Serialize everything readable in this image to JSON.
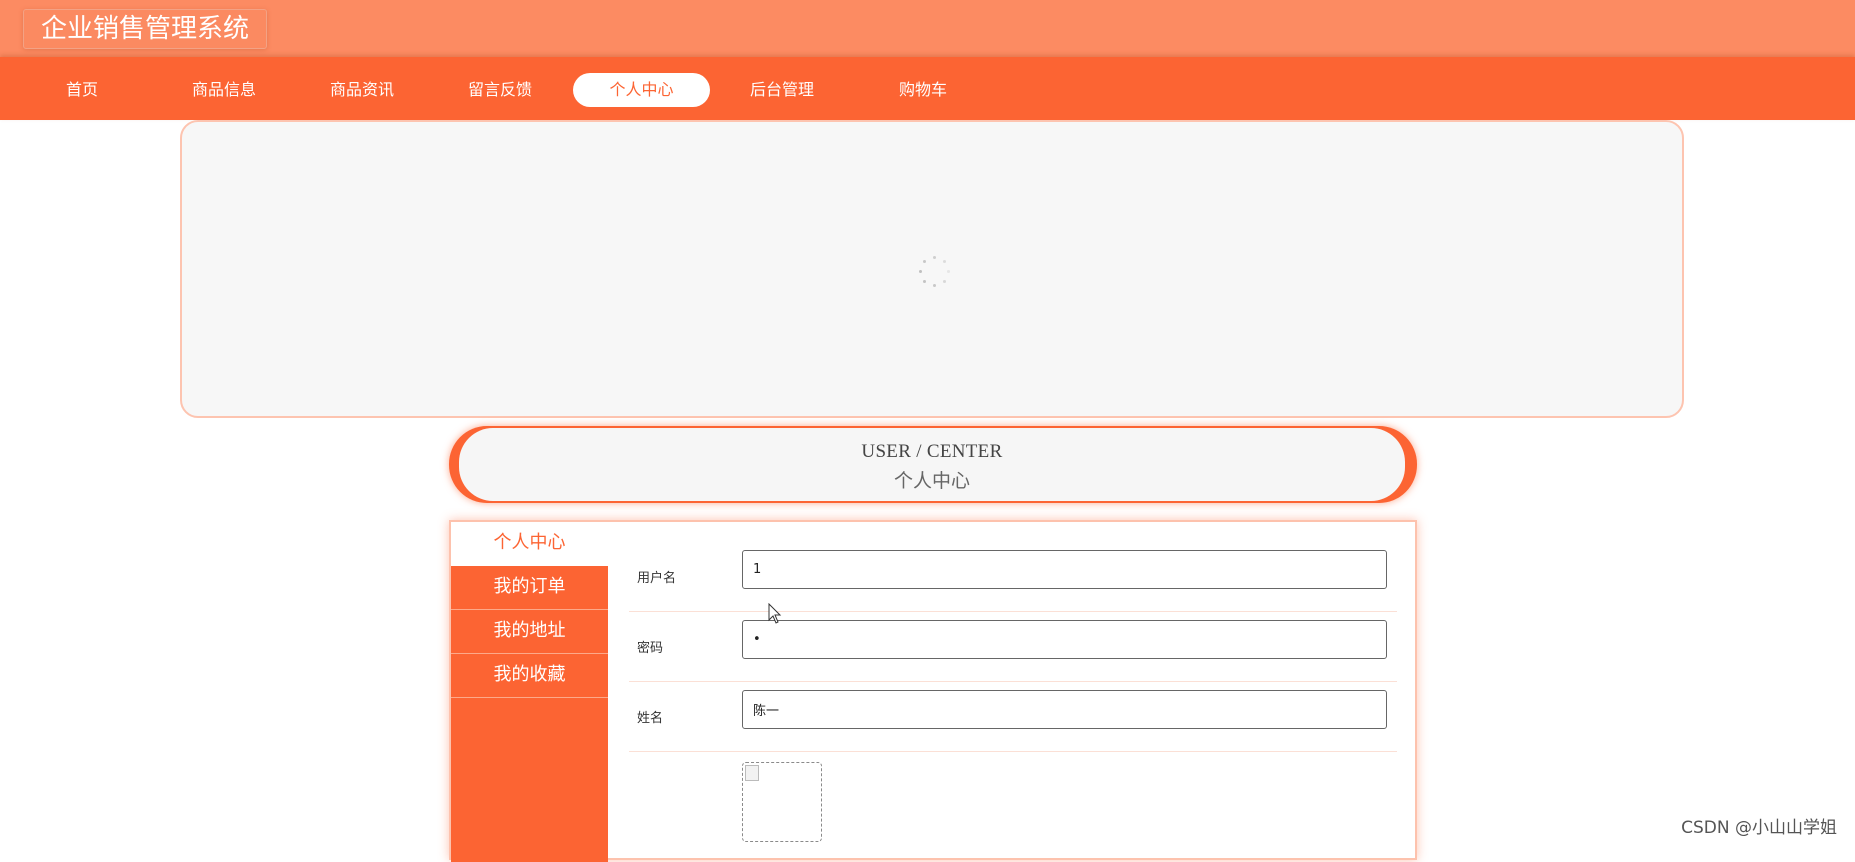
{
  "app": {
    "title": "企业销售管理系统"
  },
  "nav": {
    "items": [
      {
        "label": "首页"
      },
      {
        "label": "商品信息"
      },
      {
        "label": "商品资讯"
      },
      {
        "label": "留言反馈"
      },
      {
        "label": "个人中心",
        "active": true
      },
      {
        "label": "后台管理"
      },
      {
        "label": "购物车"
      }
    ]
  },
  "section": {
    "title_en": "USER / CENTER",
    "title_zh": "个人中心"
  },
  "sidemenu": {
    "items": [
      {
        "label": "个人中心",
        "active": true
      },
      {
        "label": "我的订单"
      },
      {
        "label": "我的地址"
      },
      {
        "label": "我的收藏"
      }
    ]
  },
  "form": {
    "username": {
      "label": "用户名",
      "value": "1"
    },
    "password": {
      "label": "密码",
      "value": "•"
    },
    "name": {
      "label": "姓名",
      "value": "陈一"
    }
  },
  "watermark": "CSDN @小山山学姐",
  "colors": {
    "primary": "#fc6433",
    "header": "#fc8b62",
    "banner_bg": "#f7f7f7"
  },
  "icons": {
    "loading": "loading-spinner-icon",
    "cursor": "mouse-cursor-icon",
    "broken_image": "broken-image-icon"
  }
}
